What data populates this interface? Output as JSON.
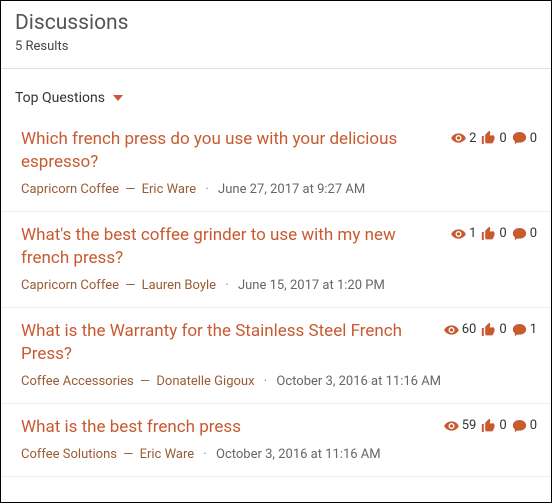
{
  "header": {
    "title": "Discussions",
    "results": "5 Results"
  },
  "sort": {
    "label": "Top Questions"
  },
  "items": [
    {
      "title": "Which french press do you use with your delicious espresso?",
      "category": "Capricorn Coffee",
      "author": "Eric Ware",
      "date": "June 27, 2017 at 9:27 AM",
      "views": "2",
      "likes": "0",
      "comments": "0"
    },
    {
      "title": "What's the best coffee grinder to use with my new french press?",
      "category": "Capricorn Coffee",
      "author": "Lauren Boyle",
      "date": "June 15, 2017 at 1:20 PM",
      "views": "1",
      "likes": "0",
      "comments": "0"
    },
    {
      "title": "What is the Warranty for the Stainless Steel French Press?",
      "category": "Coffee Accessories",
      "author": "Donatelle Gigoux",
      "date": "October 3, 2016 at 11:16 AM",
      "views": "60",
      "likes": "0",
      "comments": "1"
    },
    {
      "title": "What is the best french press",
      "category": "Coffee Solutions",
      "author": "Eric Ware",
      "date": "October 3, 2016 at 11:16 AM",
      "views": "59",
      "likes": "0",
      "comments": "0"
    }
  ]
}
